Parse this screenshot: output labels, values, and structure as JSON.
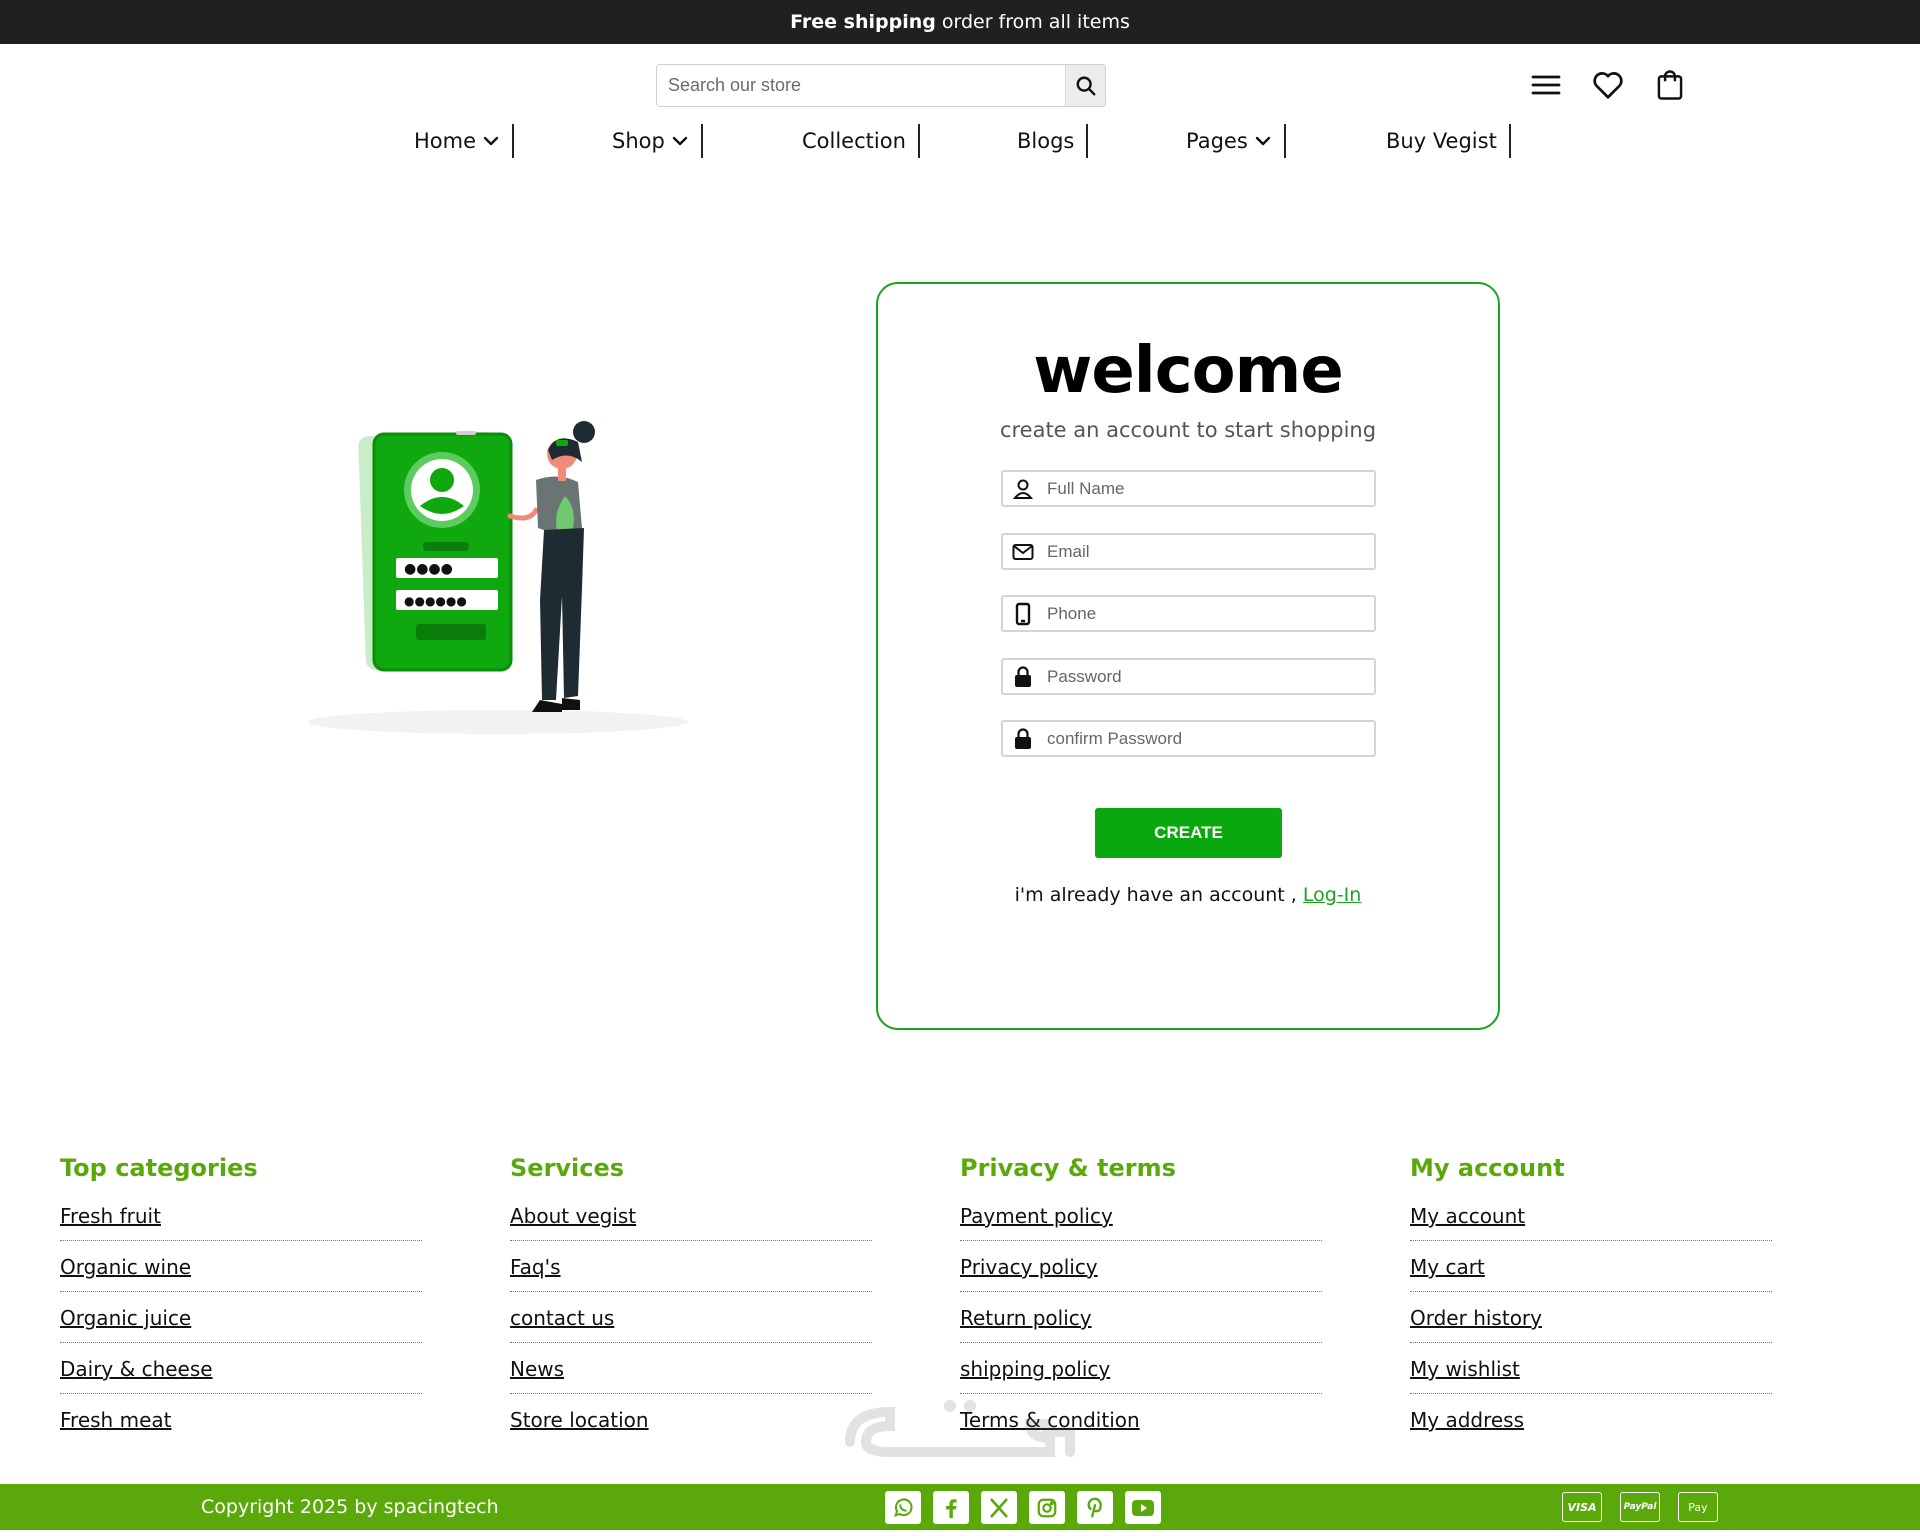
{
  "announcement": {
    "bold": "Free shipping",
    "rest": "order from all items"
  },
  "search": {
    "placeholder": "Search our store",
    "icon": "search-icon"
  },
  "header_icons": [
    "menu-icon",
    "heart-icon",
    "shopping-bag-icon"
  ],
  "nav": [
    {
      "label": "Home",
      "dropdown": true
    },
    {
      "label": "Shop",
      "dropdown": true
    },
    {
      "label": "Collection",
      "dropdown": false
    },
    {
      "label": "Blogs",
      "dropdown": false
    },
    {
      "label": "Pages",
      "dropdown": true
    },
    {
      "label": "Buy Vegist",
      "dropdown": false
    }
  ],
  "form": {
    "title": "welcome",
    "subtitle": "create an account to start shopping",
    "fields": [
      {
        "icon": "user-icon",
        "placeholder": "Full Name"
      },
      {
        "icon": "envelope-icon",
        "placeholder": "Email"
      },
      {
        "icon": "phone-icon",
        "placeholder": "Phone"
      },
      {
        "icon": "lock-icon",
        "placeholder": "Password"
      },
      {
        "icon": "lock-icon",
        "placeholder": "confirm Password"
      }
    ],
    "submit_label": "CREATE",
    "login_prompt": "i'm already have an account ,",
    "login_link": "Log-In"
  },
  "footer": {
    "columns": [
      {
        "title": "Top categories",
        "links": [
          "Fresh fruit",
          "Organic wine",
          "Organic juice",
          "Dairy & cheese",
          "Fresh meat"
        ]
      },
      {
        "title": "Services",
        "links": [
          "About vegist",
          "Faq's",
          "contact us",
          "News",
          "Store location"
        ]
      },
      {
        "title": "Privacy & terms",
        "links": [
          "Payment policy",
          "Privacy policy",
          "Return policy",
          "shipping policy",
          "Terms & condition"
        ]
      },
      {
        "title": "My account",
        "links": [
          "My account",
          "My cart",
          "Order history",
          "My wishlist",
          "My address"
        ]
      }
    ],
    "copyright": "Copyright 2025 by spacingtech",
    "social_icons": [
      "whatsapp-icon",
      "facebook-icon",
      "x-icon",
      "instagram-icon",
      "pinterest-icon",
      "youtube-icon"
    ],
    "payment_labels": [
      "VISA",
      "PayPal",
      "Pay"
    ]
  },
  "colors": {
    "accent": "#09a80f",
    "card_border": "#1aa51e",
    "footer_green": "#5aa80a",
    "topbar": "#1f2120"
  }
}
